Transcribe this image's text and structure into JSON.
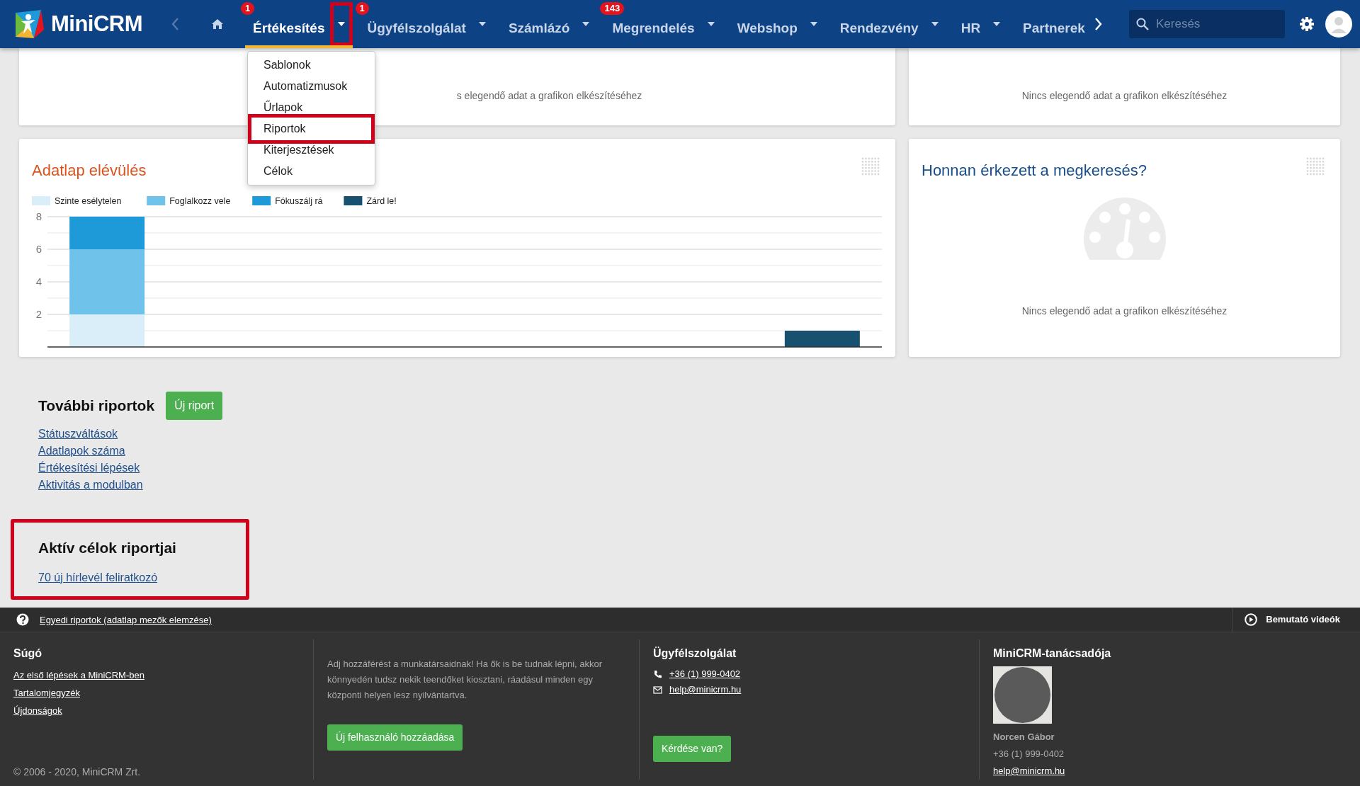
{
  "navbar": {
    "logo": "MiniCRM",
    "items": [
      {
        "label": "Értékesítés",
        "selected": true,
        "badge": "1",
        "dropdown": true,
        "annotated": true
      },
      {
        "label": "Ügyfélszolgálat",
        "selected": false,
        "badge": "1",
        "dropdown": true,
        "annotated": false
      },
      {
        "label": "Számlázó",
        "selected": false,
        "dropdown": true,
        "annotated": false
      },
      {
        "label": "Megrendelés",
        "selected": false,
        "badge": "143",
        "dropdown": true,
        "annotated": false
      },
      {
        "label": "Webshop",
        "selected": false,
        "dropdown": true,
        "annotated": false
      },
      {
        "label": "Rendezvény",
        "selected": false,
        "dropdown": true,
        "annotated": false
      },
      {
        "label": "HR",
        "selected": false,
        "dropdown": true,
        "annotated": false
      },
      {
        "label": "Partnerek",
        "selected": false,
        "dropdown": false,
        "annotated": false
      }
    ],
    "search": {
      "placeholder": "Keresés"
    }
  },
  "dropdown_menu": {
    "items": [
      {
        "label": "Sablonok",
        "annotated": false
      },
      {
        "label": "Automatizmusok",
        "annotated": false
      },
      {
        "label": "Űrlapok",
        "annotated": false
      },
      {
        "label": "Riportok",
        "annotated": true
      },
      {
        "label": "Kiterjesztések",
        "annotated": false
      },
      {
        "label": "Célok",
        "annotated": false
      }
    ]
  },
  "cards": [
    {
      "kind": "message",
      "message": "s elegendő adat a grafikon elkészítéséhez"
    },
    {
      "kind": "message",
      "message": "Nincs elegendő adat a grafikon elkészítéséhez"
    },
    {
      "kind": "chart",
      "title": "Adatlap elévülés",
      "chart_data": {
        "type": "bar",
        "stacked": true,
        "grid": true,
        "legend": true,
        "ylim": [
          0,
          8
        ],
        "yticks": [
          2,
          4,
          6,
          8
        ],
        "series": [
          {
            "name": "Szinte esélytelen",
            "color": "#daeef9",
            "values": [
              2,
              0,
              0,
              0,
              0,
              0,
              0
            ]
          },
          {
            "name": "Foglalkozz vele",
            "color": "#6fc3ea",
            "values": [
              4,
              0,
              0,
              0,
              0,
              0,
              0
            ]
          },
          {
            "name": "Fókuszálj rá",
            "color": "#1f9ad8",
            "values": [
              2,
              0,
              0,
              0,
              0,
              0,
              0
            ]
          },
          {
            "name": "Zárd le!",
            "color": "#17516f",
            "values": [
              0,
              0,
              0,
              0,
              0,
              0,
              1
            ]
          }
        ]
      }
    },
    {
      "kind": "empty_chart",
      "title": "Honnan érkezett a megkeresés?",
      "message": "Nincs elegendő adat a grafikon elkészítéséhez"
    }
  ],
  "reports": {
    "title": "További riportok",
    "button": "Új riport",
    "links": [
      "Státuszváltások",
      "Adatlapok száma",
      "Értékesítési lépések",
      "Aktivitás a modulban"
    ]
  },
  "goals": {
    "title": "Aktív célok riportjai",
    "links": [
      "70 új hírlevél feliratkozó"
    ],
    "annotated": true
  },
  "footer_bar": {
    "link": "Egyedi riportok (adatlap mezők elemzése)",
    "videos": "Bemutató videók"
  },
  "footer": {
    "help": {
      "title": "Súgó",
      "links": [
        "Az első lépések a MiniCRM-ben",
        "Tartalomjegyzék",
        "Újdonságok"
      ]
    },
    "copyright": "© 2006 - 2020, MiniCRM Zrt.",
    "invite": {
      "text": "Adj hozzáférést a munkatársaidnak! Ha ők is be tudnak lépni, akkor könnyedén tudsz nekik teendőket kiosztani, ráadásul minden egy központi helyen lesz nyilvántartva.",
      "button": "Új felhasználó hozzáadása"
    },
    "support": {
      "title": "Ügyfélszolgálat",
      "phone": "+36 (1) 999-0402",
      "email": "help@minicrm.hu",
      "button": "Kérdése van?"
    },
    "advisor": {
      "title": "MiniCRM-tanácsadója",
      "name": "Norcen Gábor",
      "phone": "+36 (1) 999-0402",
      "email": "help@minicrm.hu"
    }
  }
}
